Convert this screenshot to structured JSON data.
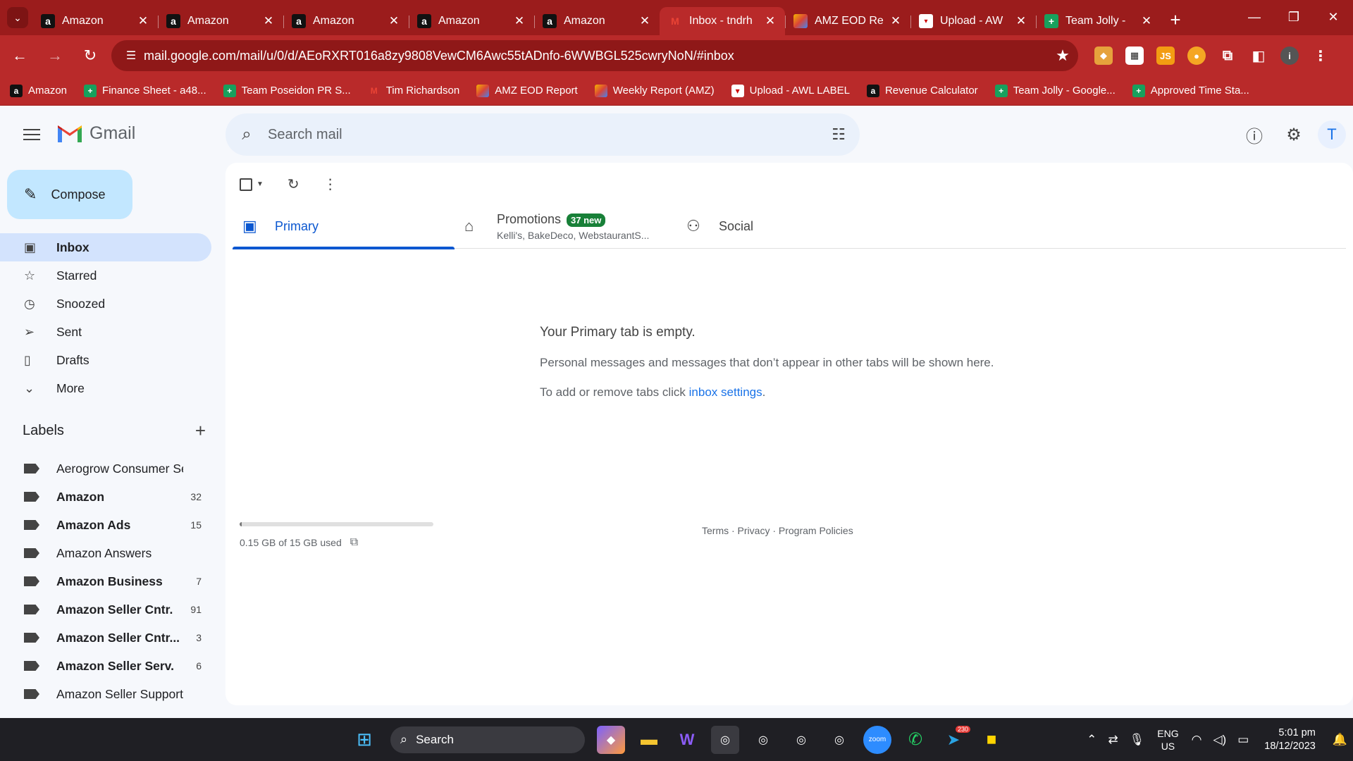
{
  "browser": {
    "tabs": [
      {
        "title": "Amazon",
        "fav": "amz",
        "fav_text": "a",
        "active": false
      },
      {
        "title": "Amazon",
        "fav": "amz",
        "fav_text": "a",
        "active": false
      },
      {
        "title": "Amazon",
        "fav": "amz",
        "fav_text": "a",
        "active": false
      },
      {
        "title": "Amazon",
        "fav": "amz",
        "fav_text": "a",
        "active": false
      },
      {
        "title": "Amazon",
        "fav": "amz",
        "fav_text": "a",
        "active": false
      },
      {
        "title": "Inbox - tndrh",
        "fav": "gm",
        "fav_text": "M",
        "active": true
      },
      {
        "title": "AMZ EOD Re",
        "fav": "multi",
        "fav_text": "",
        "active": false
      },
      {
        "title": "Upload - AW",
        "fav": "upl",
        "fav_text": "▾",
        "active": false
      },
      {
        "title": "Team Jolly -",
        "fav": "sheet",
        "fav_text": "+",
        "active": false
      }
    ],
    "url": "mail.google.com/mail/u/0/d/AEoRXRT016a8zy9808VewCM6Awc55tADnfo-6WWBGL525cwryNoN/#inbox",
    "bookmarks": [
      {
        "title": "Amazon",
        "fav": "amz",
        "fav_text": "a"
      },
      {
        "title": "Finance Sheet - a48...",
        "fav": "sheet",
        "fav_text": "+"
      },
      {
        "title": "Team Poseidon PR S...",
        "fav": "sheet",
        "fav_text": "+"
      },
      {
        "title": "Tim Richardson",
        "fav": "gm",
        "fav_text": "M"
      },
      {
        "title": "AMZ EOD Report",
        "fav": "multi",
        "fav_text": ""
      },
      {
        "title": "Weekly Report (AMZ)",
        "fav": "multi",
        "fav_text": ""
      },
      {
        "title": "Upload - AWL LABEL",
        "fav": "upl",
        "fav_text": "▾"
      },
      {
        "title": "Revenue Calculator",
        "fav": "amz",
        "fav_text": "a"
      },
      {
        "title": "Team Jolly - Google...",
        "fav": "sheet",
        "fav_text": "+"
      },
      {
        "title": "Approved Time Sta...",
        "fav": "sheet",
        "fav_text": "+"
      }
    ]
  },
  "gmail": {
    "wordmark": "Gmail",
    "search_placeholder": "Search mail",
    "avatar_letter": "T",
    "compose_label": "Compose",
    "nav": [
      {
        "label": "Inbox",
        "icon": "▣",
        "active": true
      },
      {
        "label": "Starred",
        "icon": "☆",
        "active": false
      },
      {
        "label": "Snoozed",
        "icon": "◷",
        "active": false
      },
      {
        "label": "Sent",
        "icon": "➢",
        "active": false
      },
      {
        "label": "Drafts",
        "icon": "▯",
        "active": false
      },
      {
        "label": "More",
        "icon": "⌄",
        "active": false
      }
    ],
    "labels_heading": "Labels",
    "labels": [
      {
        "name": "Aerogrow Consumer Se...",
        "count": "",
        "bold": false
      },
      {
        "name": "Amazon",
        "count": "32",
        "bold": true
      },
      {
        "name": "Amazon Ads",
        "count": "15",
        "bold": true
      },
      {
        "name": "Amazon Answers",
        "count": "",
        "bold": false
      },
      {
        "name": "Amazon Business",
        "count": "7",
        "bold": true
      },
      {
        "name": "Amazon Seller Cntr.",
        "count": "91",
        "bold": true
      },
      {
        "name": "Amazon Seller Cntr...",
        "count": "3",
        "bold": true
      },
      {
        "name": "Amazon Seller Serv.",
        "count": "6",
        "bold": true
      },
      {
        "name": "Amazon Seller Support",
        "count": "",
        "bold": false
      }
    ],
    "tabs": {
      "primary": "Primary",
      "promotions": "Promotions",
      "promotions_badge": "37 new",
      "promotions_sub": "Kelli's, BakeDeco, WebstaurantS...",
      "social": "Social"
    },
    "empty": {
      "title": "Your Primary tab is empty.",
      "line1": "Personal messages and messages that don’t appear in other tabs will be shown here.",
      "line2_prefix": "To add or remove tabs click ",
      "line2_link": "inbox settings",
      "line2_suffix": "."
    },
    "storage": {
      "text": "0.15 GB of 15 GB used",
      "fraction": 0.01
    },
    "footer": "Terms · Privacy · Program Policies"
  },
  "taskbar": {
    "search_label": "Search",
    "lang_line1": "ENG",
    "lang_line2": "US",
    "time": "5:01 pm",
    "date": "18/12/2023",
    "telegram_badge": "230"
  },
  "colors": {
    "chrome_red": "#b92a2a",
    "gmail_blue": "#0b57d0",
    "badge_green": "#188038"
  }
}
